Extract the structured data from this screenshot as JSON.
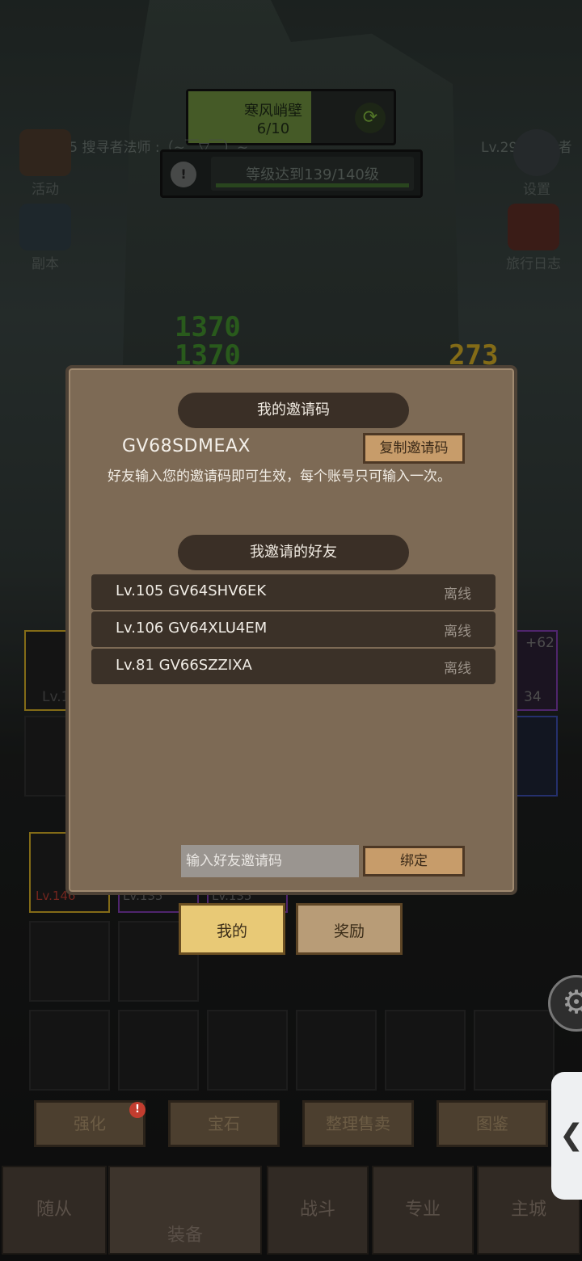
{
  "hud": {
    "quest_name": "寒风峭壁",
    "quest_progress": "6/10",
    "quest_fill": 0.6,
    "level_goal": "等级达到139/140级",
    "player_left": "Lv.145 搜寻者法师 :（~￣▽￣）~",
    "player_right": "Lv.295 搜寻者"
  },
  "side": {
    "activity": "活动",
    "dungeon": "副本",
    "settings": "设置",
    "journal": "旅行日志"
  },
  "damage": {
    "a": "1370",
    "b": "1370",
    "c": "273"
  },
  "behind": {
    "plus": "+62",
    "num": "34",
    "lv_a": "Lv.1",
    "lv_b": "Lv.146",
    "lv_c": "Lv.135",
    "lv_d": "Lv.135"
  },
  "dialog": {
    "invite_title": "我的邀请码",
    "invite_code": "GV68SDMEAX",
    "copy_label": "复制邀请码",
    "description": "好友输入您的邀请码即可生效，每个账号只可输入一次。",
    "friends_title": "我邀请的好友",
    "friends": [
      {
        "name": "Lv.105 GV64SHV6EK",
        "status": "离线"
      },
      {
        "name": "Lv.106 GV64XLU4EM",
        "status": "离线"
      },
      {
        "name": "Lv.81 GV66SZZIXA",
        "status": "离线"
      }
    ],
    "input_placeholder": "输入好友邀请码",
    "bind_label": "绑定"
  },
  "tabs": {
    "mine": "我的",
    "reward": "奖励"
  },
  "actions": {
    "enhance": "强化",
    "gem": "宝石",
    "sort_sell": "整理售卖",
    "codex": "图鉴"
  },
  "nav": {
    "follower": "随从",
    "equip": "装备",
    "battle": "战斗",
    "profession": "专业",
    "city": "主城"
  },
  "handle_glyph": "❮",
  "colors": {
    "dialog_bg": "#7d6a55",
    "banner_bg": "#3a2f26",
    "tab_active": "#e8c976",
    "damage_green": "#3f8a2c",
    "damage_yellow": "#c9a524"
  }
}
